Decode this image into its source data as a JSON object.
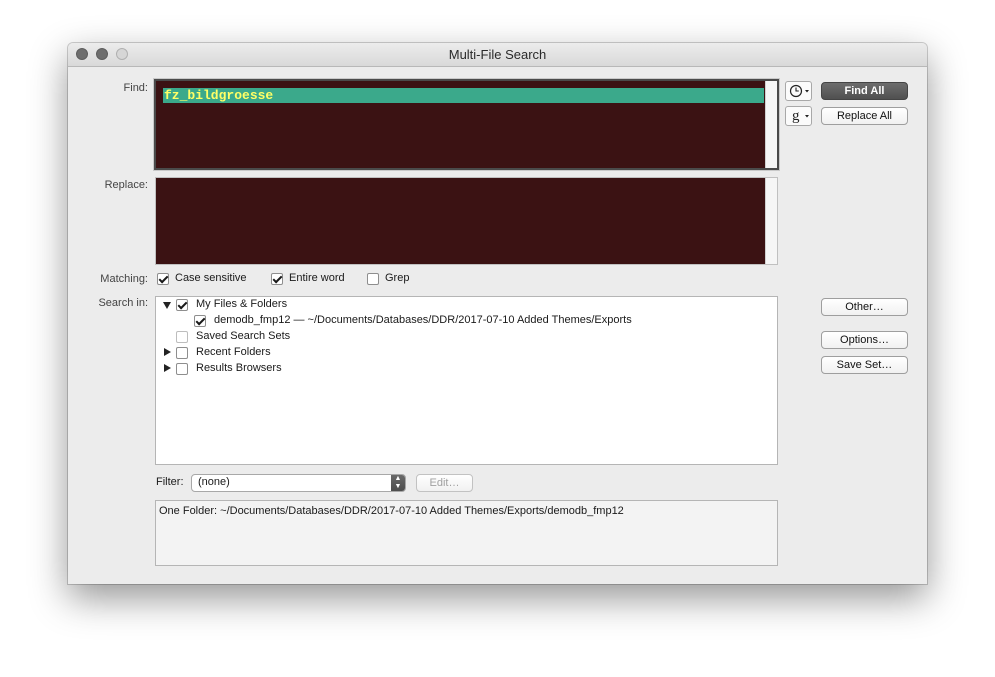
{
  "window": {
    "title": "Multi-File Search"
  },
  "find": {
    "label": "Find:",
    "value": "fz_bildgroesse"
  },
  "replace": {
    "label": "Replace:",
    "value": ""
  },
  "toolbar": {
    "history_icon": "clock-icon",
    "grep_pattern_glyph": "g",
    "find_all_label": "Find All",
    "replace_all_label": "Replace All"
  },
  "matching": {
    "label": "Matching:",
    "options": [
      {
        "label": "Case sensitive",
        "checked": true
      },
      {
        "label": "Entire word",
        "checked": true
      },
      {
        "label": "Grep",
        "checked": false
      }
    ]
  },
  "search_in": {
    "label": "Search in:",
    "items": [
      {
        "label": "My Files & Folders",
        "checked": true,
        "expanded": true
      },
      {
        "label": "demodb_fmp12 — ~/Documents/Databases/DDR/2017-07-10 Added Themes/Exports",
        "checked": true
      },
      {
        "label": "Saved Search Sets",
        "checked": false
      },
      {
        "label": "Recent Folders",
        "checked": false,
        "expanded": false
      },
      {
        "label": "Results Browsers",
        "checked": false,
        "expanded": false
      }
    ]
  },
  "side_buttons": {
    "other": "Other…",
    "options": "Options…",
    "save_set": "Save Set…"
  },
  "filter": {
    "label": "Filter:",
    "value": "(none)",
    "edit_label": "Edit…"
  },
  "summary": {
    "text": "One Folder: ~/Documents/Databases/DDR/2017-07-10 Added Themes/Exports/demodb_fmp12"
  },
  "colors": {
    "field_bg": "#3b1213",
    "selection_bg": "#3ba98b",
    "selection_text": "#ffff66"
  }
}
